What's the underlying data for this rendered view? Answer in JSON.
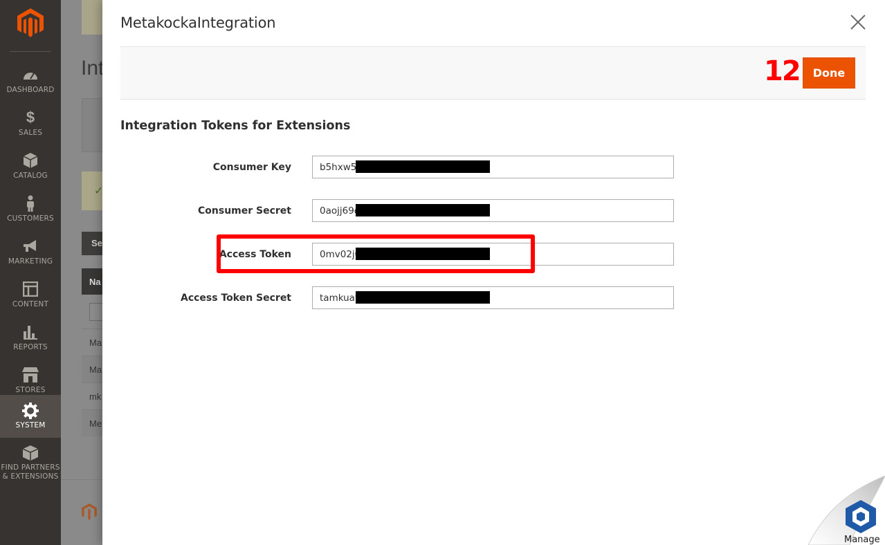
{
  "sidebar": {
    "items": [
      {
        "key": "dashboard",
        "label": "DASHBOARD",
        "icon": "dashboard-icon"
      },
      {
        "key": "sales",
        "label": "SALES",
        "icon": "dollar-icon"
      },
      {
        "key": "catalog",
        "label": "CATALOG",
        "icon": "box-icon"
      },
      {
        "key": "customers",
        "label": "CUSTOMERS",
        "icon": "person-icon"
      },
      {
        "key": "marketing",
        "label": "MARKETING",
        "icon": "megaphone-icon"
      },
      {
        "key": "content",
        "label": "CONTENT",
        "icon": "layout-icon"
      },
      {
        "key": "reports",
        "label": "REPORTS",
        "icon": "bar-chart-icon"
      },
      {
        "key": "stores",
        "label": "STORES",
        "icon": "store-icon"
      },
      {
        "key": "system",
        "label": "SYSTEM",
        "icon": "gear-icon",
        "active": true
      },
      {
        "key": "partners",
        "label_line1": "FIND PARTNERS",
        "label_line2": "& EXTENSIONS",
        "icon": "cube-icon"
      }
    ]
  },
  "background": {
    "title_fragment": "Int",
    "tab_fragment": "Se",
    "thead_fragment": "Na",
    "rows": [
      "Ma",
      "Ma",
      "mk",
      "Me"
    ]
  },
  "modal": {
    "title": "MetakockaIntegration",
    "step_number": "12",
    "done_label": "Done",
    "section_title": "Integration Tokens for Extensions",
    "fields": [
      {
        "label": "Consumer Key",
        "value": "b5hxw5"
      },
      {
        "label": "Consumer Secret",
        "value": "0aojj69c"
      },
      {
        "label": "Access Token",
        "value": "0mv02j0"
      },
      {
        "label": "Access Token Secret",
        "value": "tamkuav"
      }
    ]
  },
  "corner_widget": {
    "label": "Manage"
  },
  "colors": {
    "sidebar_bg": "#373330",
    "accent": "#eb5202",
    "highlight": "#ff0000"
  }
}
